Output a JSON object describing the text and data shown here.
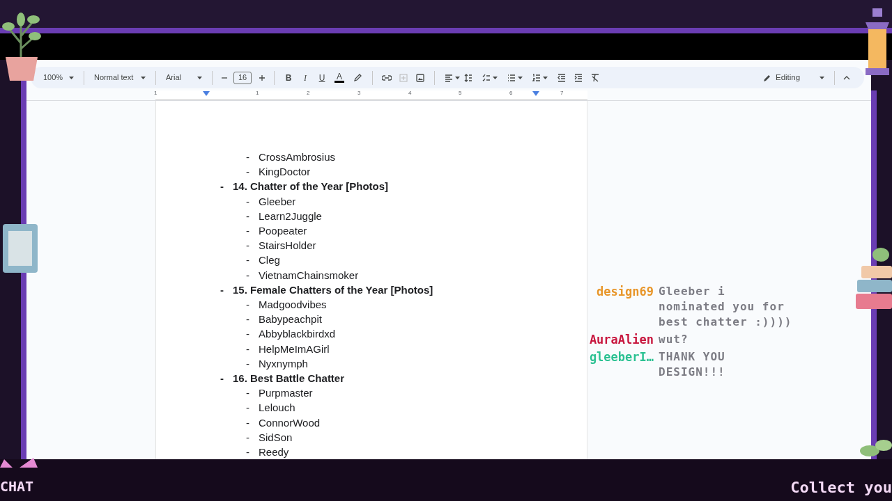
{
  "toolbar": {
    "zoom": "100%",
    "style": "Normal text",
    "font": "Arial",
    "font_size": "16",
    "format_buttons": [
      "B",
      "I",
      "U"
    ],
    "text_color_label": "A",
    "mode": "Editing"
  },
  "bullet": "-",
  "ruler": {
    "labels": [
      "1",
      "1",
      "2",
      "3",
      "4",
      "5",
      "6",
      "7"
    ]
  },
  "document": {
    "items": [
      {
        "kind": "sub",
        "text": "CrossAmbrosius"
      },
      {
        "kind": "sub",
        "text": "KingDoctor"
      },
      {
        "kind": "heading",
        "text": "14. Chatter of the Year [Photos]",
        "children": [
          {
            "kind": "sub",
            "text": "Gleeber"
          },
          {
            "kind": "sub",
            "text": "Learn2Juggle"
          },
          {
            "kind": "sub",
            "text": "Poopeater"
          },
          {
            "kind": "sub",
            "text": "StairsHolder"
          },
          {
            "kind": "sub",
            "text": "Cleg"
          },
          {
            "kind": "sub",
            "text": "VietnamChainsmoker"
          }
        ]
      },
      {
        "kind": "heading",
        "text": "15. Female Chatters of the Year [Photos]",
        "children": [
          {
            "kind": "sub",
            "text": "Madgoodvibes"
          },
          {
            "kind": "sub",
            "text": "Babypeachpit"
          },
          {
            "kind": "sub",
            "text": "Abbyblackbirdxd"
          },
          {
            "kind": "sub",
            "text": "HelpMeImAGirl"
          },
          {
            "kind": "sub",
            "text": "Nyxnymph"
          }
        ]
      },
      {
        "kind": "heading",
        "text": "16. Best Battle Chatter",
        "children": [
          {
            "kind": "sub",
            "text": "Purpmaster"
          },
          {
            "kind": "sub",
            "text": "Lelouch"
          },
          {
            "kind": "sub",
            "text": "ConnorWood"
          },
          {
            "kind": "sub",
            "text": "SidSon"
          },
          {
            "kind": "sub",
            "text": "Reedy"
          }
        ]
      }
    ]
  },
  "chat": {
    "messages": [
      {
        "user": "design69",
        "color": "#e8962a",
        "text": "Gleeber i nominated you for best chatter :))))"
      },
      {
        "user": "AuraAlien",
        "color": "#c8173f",
        "text": "wut?"
      },
      {
        "user": "gleeberI…",
        "color": "#2cc192",
        "text": "THANK YOU DESIGN!!!"
      }
    ]
  },
  "bottom_bar": {
    "left": "CHAT",
    "right": "Collect you"
  }
}
